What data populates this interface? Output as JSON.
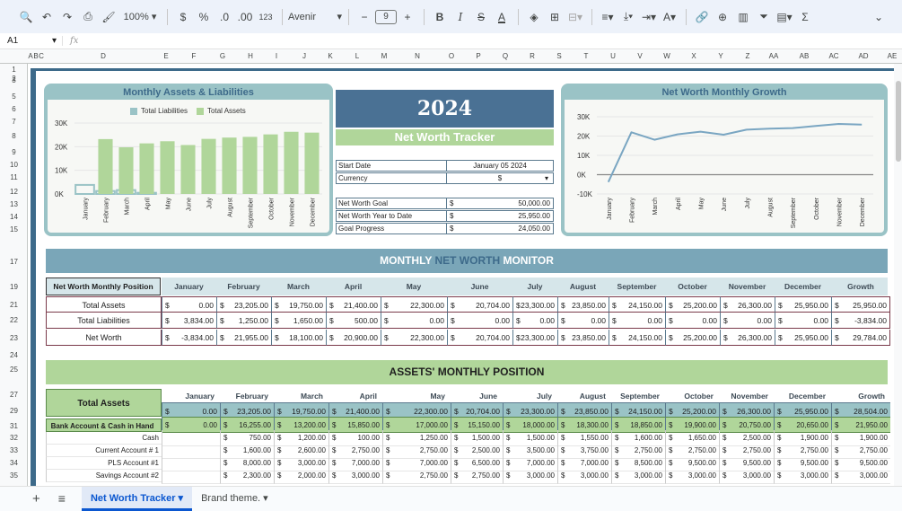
{
  "toolbar": {
    "zoom": "100%",
    "currency": "$",
    "percent": "%",
    "dec_dec": ".0",
    "inc_dec": ".00",
    "format_123": "123",
    "font": "Avenir",
    "font_size": "9",
    "bold": "B",
    "italic": "I",
    "strike": "S",
    "textcolor": "A",
    "sigma": "Σ"
  },
  "formula": {
    "cell": "A1",
    "fx": "fx",
    "content": ""
  },
  "columns": [
    "A",
    "B",
    "C",
    "D",
    "E",
    "F",
    "G",
    "H",
    "I",
    "J",
    "K",
    "L",
    "M",
    "N",
    "O",
    "P",
    "Q",
    "R",
    "S",
    "T",
    "U",
    "V",
    "W",
    "X",
    "Y",
    "Z",
    "AA",
    "AB",
    "AC",
    "AD",
    "AE"
  ],
  "rows": [
    "1",
    "2",
    "3",
    "5",
    "6",
    "7",
    "8",
    "9",
    "10",
    "11",
    "12",
    "13",
    "14",
    "15",
    "17",
    "19",
    "21",
    "22",
    "23",
    "24",
    "25",
    "27",
    "29",
    "31",
    "32",
    "33",
    "34",
    "35"
  ],
  "chart1": {
    "title": "Monthly Assets & Liabilities",
    "legend": [
      "Total Liabilities",
      "Total Assets"
    ],
    "yticks": [
      "30K",
      "20K",
      "10K",
      "0K"
    ],
    "colors": {
      "liab": "#9ac3c6",
      "assets": "#b0d69a"
    }
  },
  "chart2": {
    "title": "Net Worth Monthly Growth",
    "yticks": [
      "30K",
      "20K",
      "10K",
      "0K",
      "-10K"
    ],
    "color": "#7aa6c2"
  },
  "chart_data": [
    {
      "type": "bar",
      "title": "Monthly Assets & Liabilities",
      "categories": [
        "January",
        "February",
        "March",
        "April",
        "May",
        "June",
        "July",
        "August",
        "September",
        "October",
        "November",
        "December"
      ],
      "series": [
        {
          "name": "Total Liabilities",
          "values": [
            3834,
            1250,
            1650,
            500,
            0,
            0,
            0,
            0,
            0,
            0,
            0,
            0
          ]
        },
        {
          "name": "Total Assets",
          "values": [
            0,
            23205,
            19750,
            21400,
            22300,
            20704,
            23300,
            23850,
            24150,
            25200,
            26300,
            25950
          ]
        }
      ],
      "ylim": [
        0,
        30000
      ]
    },
    {
      "type": "line",
      "title": "Net Worth Monthly Growth",
      "categories": [
        "January",
        "February",
        "March",
        "April",
        "May",
        "June",
        "July",
        "August",
        "September",
        "October",
        "November",
        "December"
      ],
      "series": [
        {
          "values": [
            -3834,
            21955,
            18100,
            20900,
            22300,
            20704,
            23300,
            23850,
            24150,
            25200,
            26300,
            25950
          ]
        }
      ],
      "ylim": [
        -10000,
        30000
      ]
    }
  ],
  "header": {
    "year": "2024",
    "title": "Net Worth Tracker"
  },
  "info": [
    {
      "k": "Start Date",
      "v": "January 05 2024",
      "cur": ""
    },
    {
      "k": "Currency",
      "v": "$",
      "cur": ""
    },
    {
      "k": "Net Worth Goal",
      "v": "50,000.00",
      "cur": "$"
    },
    {
      "k": "Net Worth Year to Date",
      "v": "25,950.00",
      "cur": "$"
    },
    {
      "k": "Goal Progress",
      "v": "24,050.00",
      "cur": "$"
    }
  ],
  "goal_progress_fraction": 0.519,
  "monitor": {
    "pre": "MONTHLY ",
    "mid": "NET WORTH",
    "post": " MONITOR"
  },
  "months": [
    "January",
    "February",
    "March",
    "April",
    "May",
    "June",
    "July",
    "August",
    "September",
    "October",
    "November",
    "December",
    "Growth"
  ],
  "position": {
    "label": "Net Worth Monthly Position",
    "rows": [
      {
        "name": "Total Assets",
        "vals": [
          "0.00",
          "23,205.00",
          "19,750.00",
          "21,400.00",
          "22,300.00",
          "20,704.00",
          "23,300.00",
          "23,850.00",
          "24,150.00",
          "25,200.00",
          "26,300.00",
          "25,950.00",
          "25,950.00"
        ]
      },
      {
        "name": "Total Liabilities",
        "vals": [
          "3,834.00",
          "1,250.00",
          "1,650.00",
          "500.00",
          "0.00",
          "0.00",
          "0.00",
          "0.00",
          "0.00",
          "0.00",
          "0.00",
          "0.00",
          "-3,834.00"
        ]
      },
      {
        "name": "Net Worth",
        "vals": [
          "-3,834.00",
          "21,955.00",
          "18,100.00",
          "20,900.00",
          "22,300.00",
          "20,704.00",
          "23,300.00",
          "23,850.00",
          "24,150.00",
          "25,200.00",
          "26,300.00",
          "25,950.00",
          "29,784.00"
        ]
      }
    ]
  },
  "assets_banner": "ASSETS' MONTHLY POSITION",
  "assets": {
    "label": "Total Assets",
    "total": [
      "0.00",
      "23,205.00",
      "19,750.00",
      "21,400.00",
      "22,300.00",
      "20,704.00",
      "23,300.00",
      "23,850.00",
      "24,150.00",
      "25,200.00",
      "26,300.00",
      "25,950.00",
      "28,504.00"
    ],
    "rows": [
      {
        "name": "Bank Account & Cash in Hand",
        "bold": true,
        "vals": [
          "0.00",
          "16,255.00",
          "13,200.00",
          "15,850.00",
          "17,000.00",
          "15,150.00",
          "18,000.00",
          "18,300.00",
          "18,850.00",
          "19,900.00",
          "20,750.00",
          "20,650.00",
          "21,950.00"
        ]
      },
      {
        "name": "Cash",
        "vals": [
          "",
          "750.00",
          "1,200.00",
          "100.00",
          "1,250.00",
          "1,500.00",
          "1,500.00",
          "1,550.00",
          "1,600.00",
          "1,650.00",
          "2,500.00",
          "1,900.00",
          "1,900.00"
        ]
      },
      {
        "name": "Current Account # 1",
        "vals": [
          "",
          "1,600.00",
          "2,600.00",
          "2,750.00",
          "2,750.00",
          "2,500.00",
          "3,500.00",
          "3,750.00",
          "2,750.00",
          "2,750.00",
          "2,750.00",
          "2,750.00",
          "2,750.00"
        ]
      },
      {
        "name": "PLS Account #1",
        "vals": [
          "",
          "8,000.00",
          "3,000.00",
          "7,000.00",
          "7,000.00",
          "6,500.00",
          "7,000.00",
          "7,000.00",
          "8,500.00",
          "9,500.00",
          "9,500.00",
          "9,500.00",
          "9,500.00"
        ]
      },
      {
        "name": "Savings Account #2",
        "vals": [
          "",
          "2,300.00",
          "2,000.00",
          "3,000.00",
          "2,750.00",
          "2,750.00",
          "3,000.00",
          "3,000.00",
          "3,000.00",
          "3,000.00",
          "3,000.00",
          "3,000.00",
          "3,000.00"
        ]
      }
    ]
  },
  "tabs": {
    "add": "+",
    "menu": "≡",
    "active": "Net Worth Tracker",
    "other": "Brand theme."
  }
}
